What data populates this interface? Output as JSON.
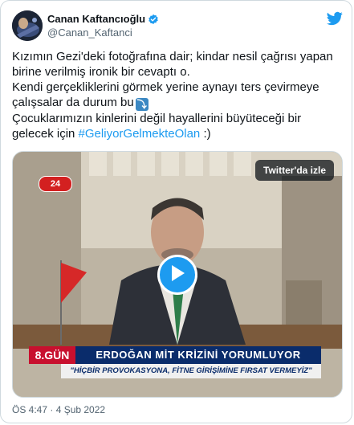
{
  "author": {
    "display_name": "Canan Kaftancıoğlu",
    "handle": "@Canan_Kaftanci"
  },
  "icons": {
    "verified": "verified-badge-icon",
    "brand": "twitter-bird-icon",
    "play": "play-icon",
    "emoji": "right-arrow-curving-down-emoji"
  },
  "colors": {
    "accent": "#1d9bf0",
    "text": "#0f1419",
    "muted": "#536471"
  },
  "tweet": {
    "line1": "Kızımın Gezi'deki fotoğrafına dair; kindar nesil çağrısı yapan birine verilmiş ironik bir cevaptı o.",
    "line2": "Kendi gerçekliklerini görmek yerine aynayı ters çevirmeye çalışsalar da durum bu",
    "line2_emoji": "⤵",
    "line3": "Çocuklarımızın kinlerini değil hayallerini büyüteceği bir gelecek için ",
    "hashtag": "#GeliyorGelmekteOlan",
    "line3_end": " :)"
  },
  "media": {
    "watch_label": "Twitter'da izle",
    "ticker_day": "8.GÜN",
    "ticker_headline": "ERDOĞAN MİT KRİZİNİ YORUMLUYOR",
    "ticker_sub": "\"HİÇBİR PROVOKASYONA, FİTNE GİRİŞİMİNE FIRSAT VERMEYİZ\""
  },
  "footer": {
    "timestamp": "ÖS 4:47 · 4 Şub 2022"
  }
}
